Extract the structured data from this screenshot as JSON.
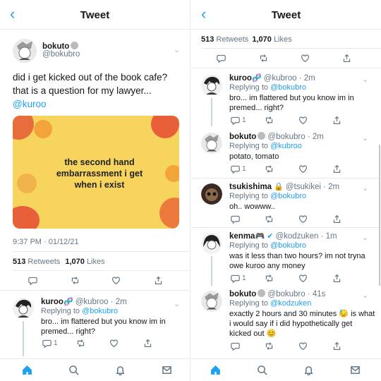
{
  "left": {
    "header": {
      "back": "‹",
      "title": "Tweet"
    },
    "tweet": {
      "display_name": "bokuto",
      "handle": "@bokubro",
      "text_line1": "did i get kicked out of the book cafe?",
      "text_line2": "that is a question for my lawyer...",
      "mention": "@kuroo",
      "meme_text": "the second hand embarrassment i get when i exist",
      "timestamp": "9:37 PM · 01/12/21",
      "retweets": "513",
      "retweets_label": "Retweets",
      "likes": "1,070",
      "likes_label": "Likes"
    },
    "reply": {
      "display_name": "kuroo",
      "emoji": "🧬",
      "handle": "@kubroo · 2m",
      "replying_label": "Replying to",
      "replying_to": "@bokubro",
      "text_line1": "bro... im flattered but you know im in",
      "text_line2": "premed... right?",
      "reply_count": "1"
    }
  },
  "right": {
    "header": {
      "back": "‹",
      "title": "Tweet"
    },
    "stats": {
      "retweets": "513",
      "retweets_label": "Retweets",
      "likes": "1,070",
      "likes_label": "Likes"
    },
    "replies": [
      {
        "name": "kuroo",
        "emoji": "🧬",
        "handle": "@kubroo · 2m",
        "replying_label": "Replying to",
        "replying_to": "@bokubro",
        "line1": "bro... im flattered but you know im in",
        "line2": "premed... right?",
        "count": "1"
      },
      {
        "name": "bokuto",
        "emoji": "",
        "handle": "@bokubro · 2m",
        "replying_label": "Replying to",
        "replying_to": "@kubroo",
        "line1": "potato, tomato",
        "line2": "",
        "count": "1"
      },
      {
        "name": "tsukishima",
        "emoji": "🔒",
        "handle": "@tsukikei · 2m",
        "replying_label": "Replying to",
        "replying_to": "@bokubro",
        "line1": "oh.. wowww..",
        "line2": "",
        "count": ""
      },
      {
        "name": "kenma",
        "emoji": "🎮",
        "handle": "@kodzuken · 1m",
        "replying_label": "Replying to",
        "replying_to": "@bokubro",
        "line1": "was it less than two hours? im not tryna",
        "line2": "owe kuroo any money",
        "count": "1"
      },
      {
        "name": "bokuto",
        "emoji": "",
        "handle": "@bokubro · 41s",
        "replying_label": "Replying to",
        "replying_to": "@kodzuken",
        "line1": "exactly 2 hours and 30 minutes 😓 is what",
        "line2": "i would say if i did hypothetically get",
        "line3": "kicked out 😊",
        "count": ""
      }
    ]
  },
  "colors": {
    "accent": "#1da1f2",
    "muted": "#657786",
    "verified": "#1da1f2"
  }
}
